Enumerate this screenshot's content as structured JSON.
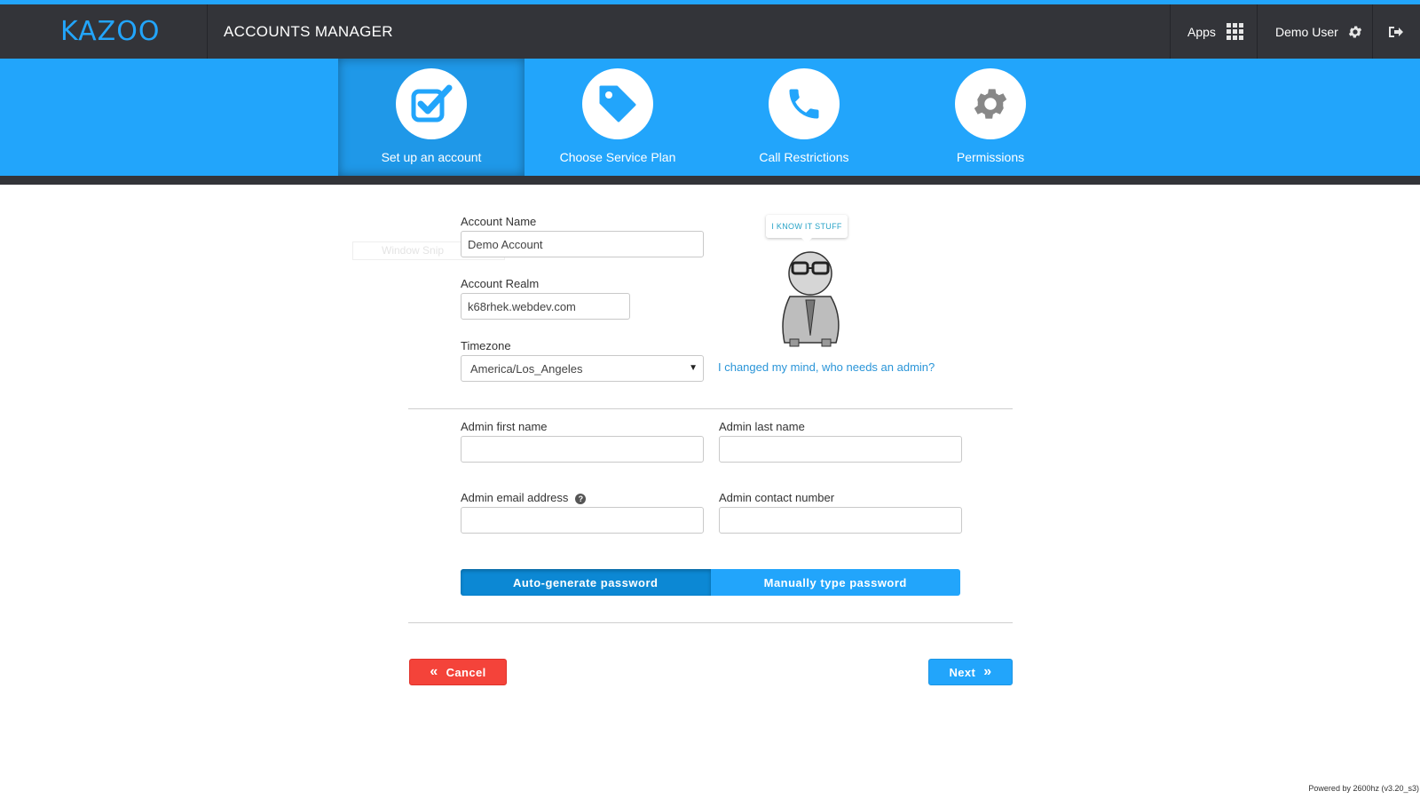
{
  "header": {
    "logo": "KAZOO",
    "app_title": "ACCOUNTS MANAGER",
    "apps_label": "Apps",
    "user_label": "Demo User"
  },
  "steps": [
    {
      "label": "Set up an account",
      "icon": "checkbox-icon",
      "active": true
    },
    {
      "label": "Choose Service Plan",
      "icon": "tag-icon",
      "active": false
    },
    {
      "label": "Call Restrictions",
      "icon": "phone-icon",
      "active": false
    },
    {
      "label": "Permissions",
      "icon": "gear-icon",
      "active": false
    }
  ],
  "form": {
    "account_name_label": "Account Name",
    "account_name_value": "Demo Account",
    "account_realm_label": "Account Realm",
    "account_realm_value": "k68rhek.webdev.com",
    "timezone_label": "Timezone",
    "timezone_value": "America/Los_Angeles",
    "ghost_text": "Window Snip",
    "mascot_speech": "I KNOW IT STUFF",
    "no_admin_link": "I changed my mind, who needs an admin?",
    "admin_first_name_label": "Admin first name",
    "admin_first_name_value": "",
    "admin_last_name_label": "Admin last name",
    "admin_last_name_value": "",
    "admin_email_label": "Admin email address",
    "admin_email_value": "",
    "admin_contact_label": "Admin contact number",
    "admin_contact_value": "",
    "password_options": [
      "Auto-generate password",
      "Manually type password"
    ],
    "password_selected": "Auto-generate password"
  },
  "actions": {
    "cancel_label": "Cancel",
    "next_label": "Next"
  },
  "footer": {
    "powered_by": "Powered by 2600hz  (v3.20_s3)"
  },
  "colors": {
    "accent": "#22a5fb",
    "topbar": "#333439",
    "cancel": "#f4433a",
    "link": "#2a95d8"
  }
}
